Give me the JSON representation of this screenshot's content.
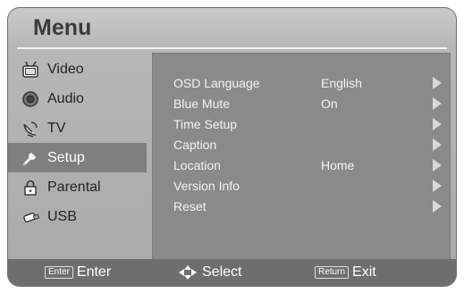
{
  "menu": {
    "title": "Menu",
    "sidebar": [
      {
        "label": "Video",
        "icon": "tv-video-icon"
      },
      {
        "label": "Audio",
        "icon": "speaker-icon"
      },
      {
        "label": "TV",
        "icon": "satellite-dish-icon"
      },
      {
        "label": "Setup",
        "icon": "wrench-icon",
        "active": true
      },
      {
        "label": "Parental",
        "icon": "lock-icon"
      },
      {
        "label": "USB",
        "icon": "usb-drive-icon"
      }
    ],
    "settings": [
      {
        "label": "OSD Language",
        "value": "English"
      },
      {
        "label": "Blue Mute",
        "value": "On"
      },
      {
        "label": "Time Setup",
        "value": ""
      },
      {
        "label": "Caption",
        "value": ""
      },
      {
        "label": "Location",
        "value": "Home"
      },
      {
        "label": "Version Info",
        "value": ""
      },
      {
        "label": "Reset",
        "value": ""
      }
    ],
    "footer": {
      "enter_badge": "Enter",
      "enter_label": "Enter",
      "select_label": "Select",
      "return_badge": "Return",
      "exit_label": "Exit"
    }
  }
}
